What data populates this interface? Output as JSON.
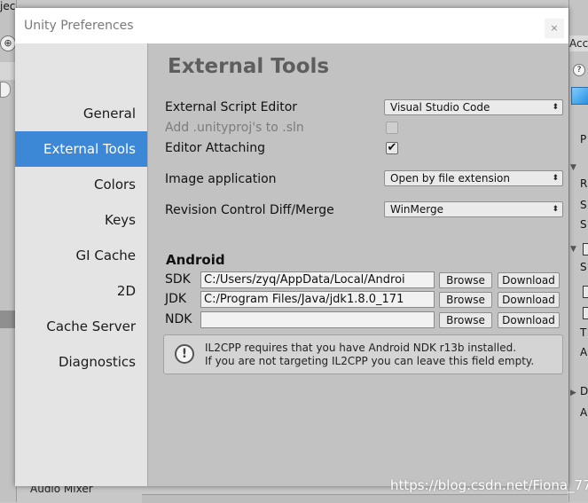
{
  "window": {
    "title": "Unity Preferences",
    "close_glyph": "×"
  },
  "sidebar": {
    "items": [
      {
        "label": "General"
      },
      {
        "label": "External Tools"
      },
      {
        "label": "Colors"
      },
      {
        "label": "Keys"
      },
      {
        "label": "GI Cache"
      },
      {
        "label": "2D"
      },
      {
        "label": "Cache Server"
      },
      {
        "label": "Diagnostics"
      }
    ],
    "active_index": 1
  },
  "content": {
    "heading": "External Tools",
    "external_script_editor": {
      "label": "External Script Editor",
      "value": "Visual Studio Code"
    },
    "add_unityproj": {
      "label": "Add .unityproj's to .sln",
      "checked": false
    },
    "editor_attaching": {
      "label": "Editor Attaching",
      "checked": true,
      "check_glyph": "✔"
    },
    "image_application": {
      "label": "Image application",
      "value": "Open by file extension"
    },
    "revision_control": {
      "label": "Revision Control Diff/Merge",
      "value": "WinMerge"
    },
    "dropdown_arrow": "⬍",
    "android": {
      "section_title": "Android",
      "sdk": {
        "label": "SDK",
        "path": "C:/Users/zyq/AppData/Local/Androi"
      },
      "jdk": {
        "label": "JDK",
        "path": "C:/Program Files/Java/jdk1.8.0_171"
      },
      "ndk": {
        "label": "NDK",
        "path": ""
      },
      "browse_label": "Browse",
      "download_label": "Download",
      "help": {
        "line1": "IL2CPP requires that you have Android NDK r13b installed.",
        "line2": "If you are not targeting IL2CPP you can leave this field empty.",
        "icon_glyph": "!"
      }
    }
  },
  "background": {
    "top_left_text": "jec",
    "gizmo_glyph": "⊕",
    "right_tab": "Acc",
    "right_circle_glyph": "?",
    "right_labels": [
      "P",
      "R",
      "S",
      "S",
      "S",
      "T",
      "A",
      "D",
      "A"
    ],
    "bottom_left_text": "Audio Mixer"
  },
  "watermark": "https://blog.csdn.net/Fiona_77",
  "colors": {
    "selection": "#3d88d6",
    "sidebar_bg": "#e4e4e4",
    "content_bg": "#c2c2c2",
    "titlebar_bg": "#ffffff"
  }
}
